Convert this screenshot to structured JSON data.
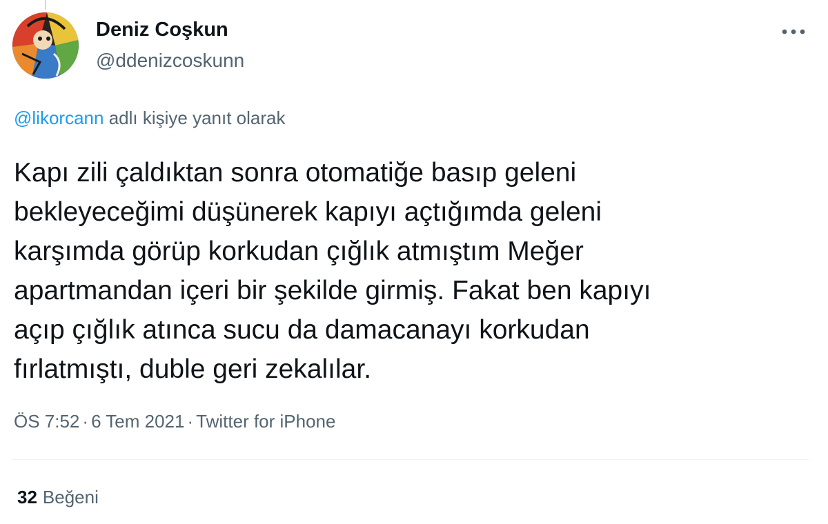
{
  "author": {
    "name": "Deniz Coşkun",
    "handle": "@ddenizcoskunn"
  },
  "reply": {
    "mention": "@likorcann",
    "suffix": "adlı kişiye yanıt olarak"
  },
  "tweet": {
    "lines": [
      "Kapı zili çaldıktan sonra otomatiğe basıp geleni",
      "bekleyeceğimi düşünerek kapıyı açtığımda geleni",
      "karşımda görüp korkudan çığlık atmıştım Meğer",
      "apartmandan içeri bir şekilde girmiş. Fakat ben kapıyı",
      "açıp çığlık atınca sucu da damacanayı korkudan",
      "fırlatmıştı, duble geri zekalılar."
    ]
  },
  "meta": {
    "time": "ÖS 7:52",
    "separator": "·",
    "date": "6 Tem 2021",
    "source": "Twitter for iPhone"
  },
  "stats": {
    "likes_count": "32",
    "likes_label": "Beğeni"
  },
  "icons": {
    "more": "more-horizontal-icon"
  },
  "colors": {
    "accent": "#1d9bf0",
    "secondary_text": "#536471",
    "primary_text": "#0f1419",
    "divider": "#eff3f4"
  }
}
